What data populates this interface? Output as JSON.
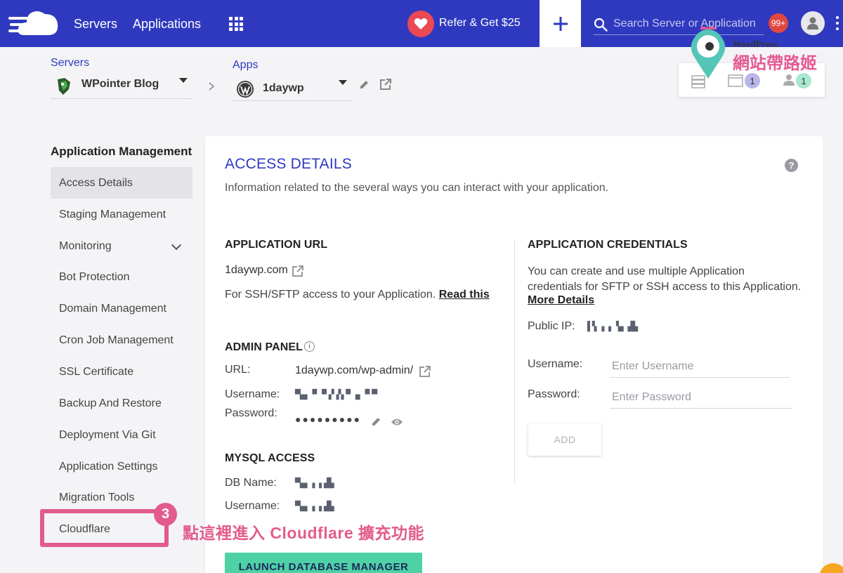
{
  "topbar": {
    "nav": [
      "Servers",
      "Applications"
    ],
    "refer_label": "Refer & Get $25",
    "search_placeholder": "Search Server or Application",
    "notifications_count": "99+"
  },
  "breadcrumb": {
    "servers_label": "Servers",
    "server_name": "WPointer Blog",
    "apps_label": "Apps",
    "app_name": "1daywp"
  },
  "watermark": {
    "small": "WordPress",
    "big": "網站帶路姬",
    "count_apps": "1",
    "count_users": "1"
  },
  "sidebar": {
    "title": "Application Management",
    "items": [
      {
        "label": "Access Details",
        "active": true
      },
      {
        "label": "Staging Management"
      },
      {
        "label": "Monitoring",
        "expandable": true
      },
      {
        "label": "Bot Protection"
      },
      {
        "label": "Domain Management"
      },
      {
        "label": "Cron Job Management"
      },
      {
        "label": "SSL Certificate"
      },
      {
        "label": "Backup And Restore"
      },
      {
        "label": "Deployment Via Git"
      },
      {
        "label": "Application Settings"
      },
      {
        "label": "Migration Tools"
      },
      {
        "label": "Cloudflare"
      }
    ]
  },
  "annotation": {
    "step": "3",
    "text": "點這裡進入 Cloudflare 擴充功能"
  },
  "main": {
    "title": "ACCESS DETAILS",
    "subtitle": "Information related to the several ways you can interact with your application.",
    "app_url": {
      "heading": "APPLICATION URL",
      "url": "1daywp.com",
      "ssh_text": "For SSH/SFTP access to your Application.",
      "read_this": "Read this"
    },
    "admin_panel": {
      "heading": "ADMIN PANEL",
      "url_label": "URL:",
      "url_value": "1daywp.com/wp-admin/",
      "username_label": "Username:",
      "username_value": "▀▄▖▝▘▝▘▞▗▚▝▘▗▖▝▘▀",
      "password_label": "Password:",
      "password_value": "●●●●●●●●●"
    },
    "mysql": {
      "heading": "MYSQL ACCESS",
      "db_label": "DB Name:",
      "db_value": "▀▄▖▗ ▖▟▙",
      "username_label": "Username:",
      "username_value": "▀▄▖▗ ▖▟▙",
      "launch_label": "LAUNCH DATABASE MANAGER"
    },
    "credentials": {
      "heading": "APPLICATION CREDENTIALS",
      "desc_1": "You can create and use multiple Application",
      "desc_2": "credentials for SFTP or SSH access to this Application.",
      "more": "More Details",
      "public_ip_label": "Public IP:",
      "public_ip_value": "▐▝▖▗ ▖▝▄ ▟▙",
      "username_label": "Username:",
      "username_placeholder": "Enter Username",
      "password_label": "Password:",
      "password_placeholder": "Enter Password",
      "add_label": "ADD"
    }
  },
  "colors": {
    "topbar": "#2f39bf",
    "accent_pink": "#e35b8c",
    "launch_green": "#4fd1a6"
  }
}
